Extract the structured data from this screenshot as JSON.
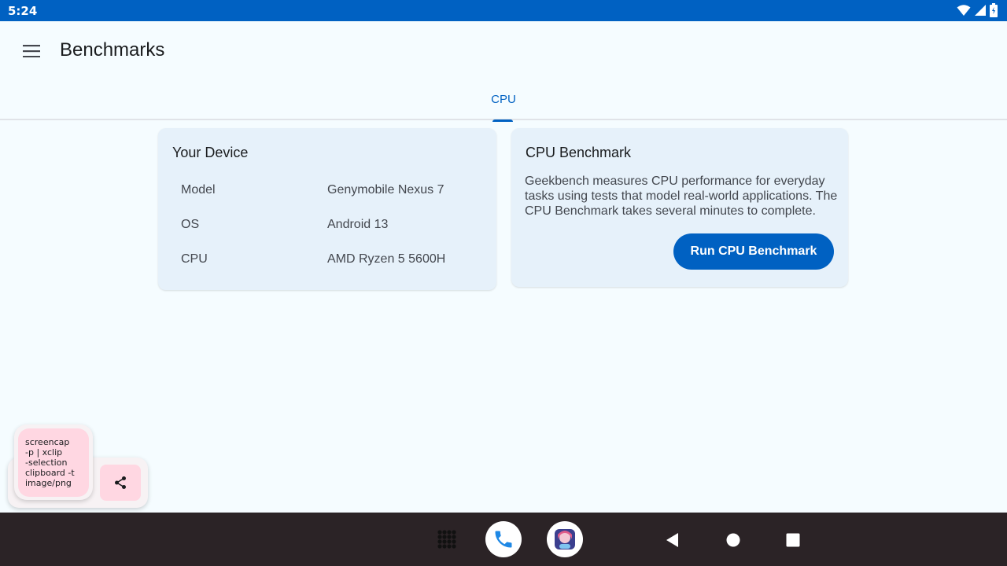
{
  "status_bar": {
    "time": "5:24"
  },
  "app_bar": {
    "title": "Benchmarks"
  },
  "tabs": [
    {
      "label": "CPU",
      "selected": true
    }
  ],
  "device_card": {
    "title": "Your Device",
    "rows": [
      {
        "key": "Model",
        "value": "Genymobile Nexus 7"
      },
      {
        "key": "OS",
        "value": "Android 13"
      },
      {
        "key": "CPU",
        "value": "AMD Ryzen 5 5600H"
      }
    ]
  },
  "bench_card": {
    "title": "CPU Benchmark",
    "description": "Geekbench measures CPU performance for everyday tasks using tests that model real-world applications. The CPU Benchmark takes several minutes to complete.",
    "button_label": "Run CPU Benchmark"
  },
  "overlay": {
    "command_text": "screencap\n-p | xclip\n-selection\nclipboard -t\nimage/png"
  },
  "colors": {
    "accent": "#0061c2",
    "background": "#f5fcff",
    "card": "#e6f1fa",
    "nav_bar": "#2b2326",
    "bubble": "#ffd7e2"
  },
  "icons": [
    "wifi-icon",
    "signal-icon",
    "battery-icon",
    "menu-icon",
    "share-icon",
    "apps-grid-icon",
    "phone-icon",
    "avatar-icon",
    "back-icon",
    "home-icon",
    "recents-icon"
  ]
}
